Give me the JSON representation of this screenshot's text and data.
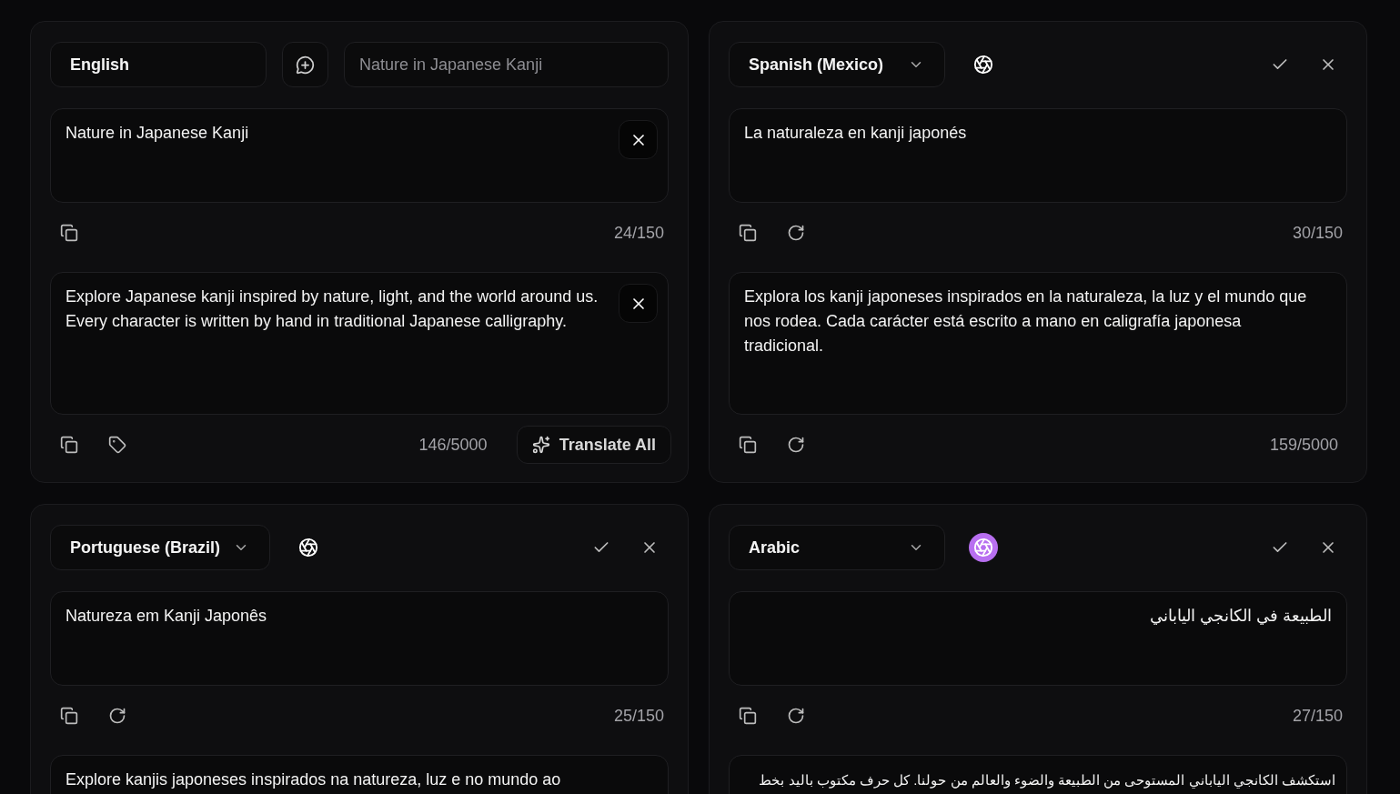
{
  "panels": [
    {
      "kind": "source",
      "language": "English",
      "title_input": {
        "placeholder": "Nature in Japanese Kanji"
      },
      "title": "Nature in Japanese Kanji",
      "title_count": "24/150",
      "description": "Explore Japanese kanji inspired by nature, light, and the world around us. Every character is written by hand in traditional Japanese calligraphy.",
      "description_count": "146/5000",
      "translate_label": "Translate All",
      "rtl": false
    },
    {
      "kind": "target",
      "language": "Spanish (Mexico)",
      "ai_active": false,
      "title": "La naturaleza en kanji japonés",
      "title_count": "30/150",
      "description": "Explora los kanji japoneses inspirados en la naturaleza, la luz y el mundo que nos rodea. Cada carácter está escrito a mano en caligrafía japonesa tradicional.",
      "description_count": "159/5000",
      "rtl": false
    },
    {
      "kind": "target",
      "language": "Portuguese (Brazil)",
      "ai_active": false,
      "title": "Natureza em Kanji Japonês",
      "title_count": "25/150",
      "description": "Explore kanjis japoneses inspirados na natureza, luz e no mundo ao",
      "rtl": false
    },
    {
      "kind": "target",
      "language": "Arabic",
      "ai_active": true,
      "title": "الطبيعة في الكانجي الياباني",
      "title_count": "27/150",
      "description": "استكشف الكانجي الياباني المستوحى من الطبيعة والضوء والعالم من حولنا. كل حرف مكتوب باليد بخط",
      "rtl": true
    }
  ]
}
